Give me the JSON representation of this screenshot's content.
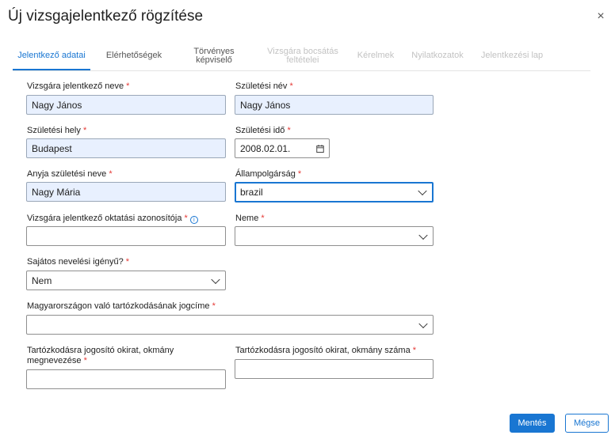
{
  "dialog": {
    "title": "Új vizsgajelentkező rögzítése",
    "close_symbol": "×"
  },
  "tabs": [
    {
      "label": "Jelentkező adatai",
      "state": "active"
    },
    {
      "label": "Elérhetőségek",
      "state": "normal"
    },
    {
      "label_line1": "Törvényes",
      "label_line2": "képviselő",
      "state": "normal"
    },
    {
      "label_line1": "Vizsgára bocsátás",
      "label_line2": "feltételei",
      "state": "disabled"
    },
    {
      "label": "Kérelmek",
      "state": "disabled"
    },
    {
      "label": "Nyilatkozatok",
      "state": "disabled"
    },
    {
      "label": "Jelentkezési lap",
      "state": "disabled"
    }
  ],
  "required_mark": "*",
  "info_symbol": "i",
  "fields": {
    "name": {
      "label": "Vizsgára jelentkező neve",
      "value": "Nagy János"
    },
    "birth_name": {
      "label": "Születési név",
      "value": "Nagy János"
    },
    "birth_place": {
      "label": "Születési hely",
      "value": "Budapest"
    },
    "birth_date": {
      "label": "Születési idő",
      "value": "2008.02.01."
    },
    "mother_name": {
      "label": "Anyja születési neve",
      "value": "Nagy Mária"
    },
    "citizenship": {
      "label": "Állampolgárság",
      "value": "brazil"
    },
    "education_id": {
      "label": "Vizsgára jelentkező oktatási azonosítója",
      "value": ""
    },
    "gender": {
      "label": "Neme",
      "value": ""
    },
    "special_needs": {
      "label": "Sajátos nevelési igényű?",
      "value": "Nem"
    },
    "residence_basis": {
      "label": "Magyarországon való tartózkodásának jogcíme",
      "value": ""
    },
    "residence_doc_name": {
      "label_line1": "Tartózkodásra jogosító okirat, okmány",
      "label_line2": "megnevezése",
      "value": ""
    },
    "residence_doc_number": {
      "label": "Tartózkodásra jogosító okirat, okmány száma",
      "value": ""
    }
  },
  "buttons": {
    "save": "Mentés",
    "cancel": "Mégse"
  },
  "colors": {
    "accent": "#1976d2",
    "required": "#e53935",
    "filled_bg": "#e8f0fe"
  }
}
